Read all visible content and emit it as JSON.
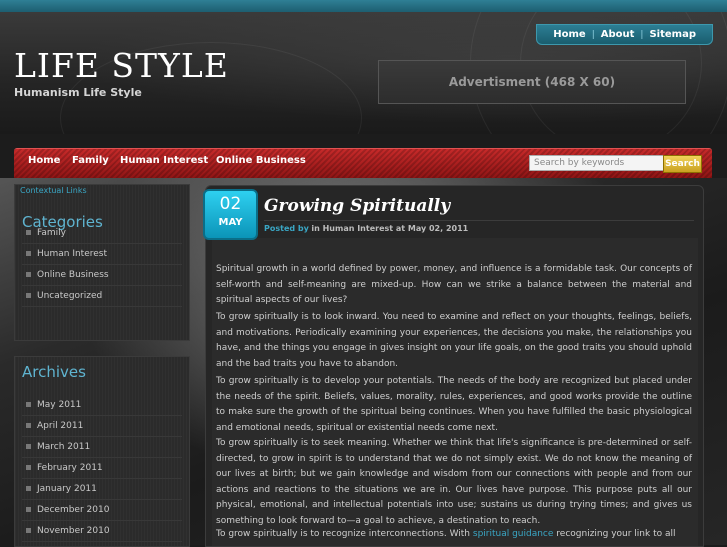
{
  "top_links": [
    "Home",
    "About",
    "Sitemap"
  ],
  "site": {
    "title": "LIFE STYLE",
    "tagline": "Humanism Life Style",
    "ad_text": "Advertisment (468 X 60)"
  },
  "nav": {
    "items": [
      "Home",
      "Family",
      "Human Interest",
      "Online Business"
    ],
    "search_placeholder": "Search by keywords",
    "search_button": "Search"
  },
  "sidebar": {
    "contextual_links": "Contextual Links",
    "categories_title": "Categories",
    "categories": [
      "Family",
      "Human Interest",
      "Online Business",
      "Uncategorized"
    ],
    "archives_title": "Archives",
    "archives": [
      "May 2011",
      "April 2011",
      "March 2011",
      "February 2011",
      "January 2011",
      "December 2010",
      "November 2010"
    ]
  },
  "post": {
    "date_day": "02",
    "date_month": "MAY",
    "title": "Growing Spiritually",
    "posted_by": "Posted by",
    "meta_rest": "in Human Interest at May 02, 2011",
    "paragraphs": [
      "Spiritual growth in a world defined by power, money, and influence is a formidable task. Our concepts of self-worth and self-meaning are mixed-up. How can we strike a balance between the material and spiritual aspects of our lives?",
      "To grow spiritually is to look inward. You need to examine and reflect on your thoughts, feelings, beliefs, and motivations. Periodically examining your experiences, the decisions you make, the relationships you have, and the things you engage in gives insight on your life goals, on the good traits you should uphold and the bad traits you have to abandon.",
      "To grow spiritually is to develop your potentials. The needs of the body are recognized but placed under the needs of the spirit. Beliefs, values, morality, rules, experiences, and good works provide the outline to make sure the growth of the spiritual being continues. When you have fulfilled the basic physiological and emotional needs, spiritual or existential needs come next.",
      "To grow spiritually is to seek meaning. Whether we think that life's significance is pre-determined or self-directed, to grow in spirit is to understand that we do not simply exist. We do not know the meaning of our lives at birth; but we gain knowledge and wisdom from our connections with people and from our actions and reactions to the situations we are in. Our lives have purpose. This purpose puts all our physical, emotional, and intellectual potentials into use; sustains us during trying times; and gives us something to look forward to—a goal to achieve, a destination to reach."
    ],
    "last_para_start": "To grow spiritually is to recognize interconnections. With ",
    "last_para_link": "spiritual guidance",
    "last_para_end": " recognizing your link to all"
  },
  "colors": {
    "accent_blue": "#3aa6c4",
    "nav_red": "#c72a2a",
    "search_gold": "#e0bc3a"
  }
}
